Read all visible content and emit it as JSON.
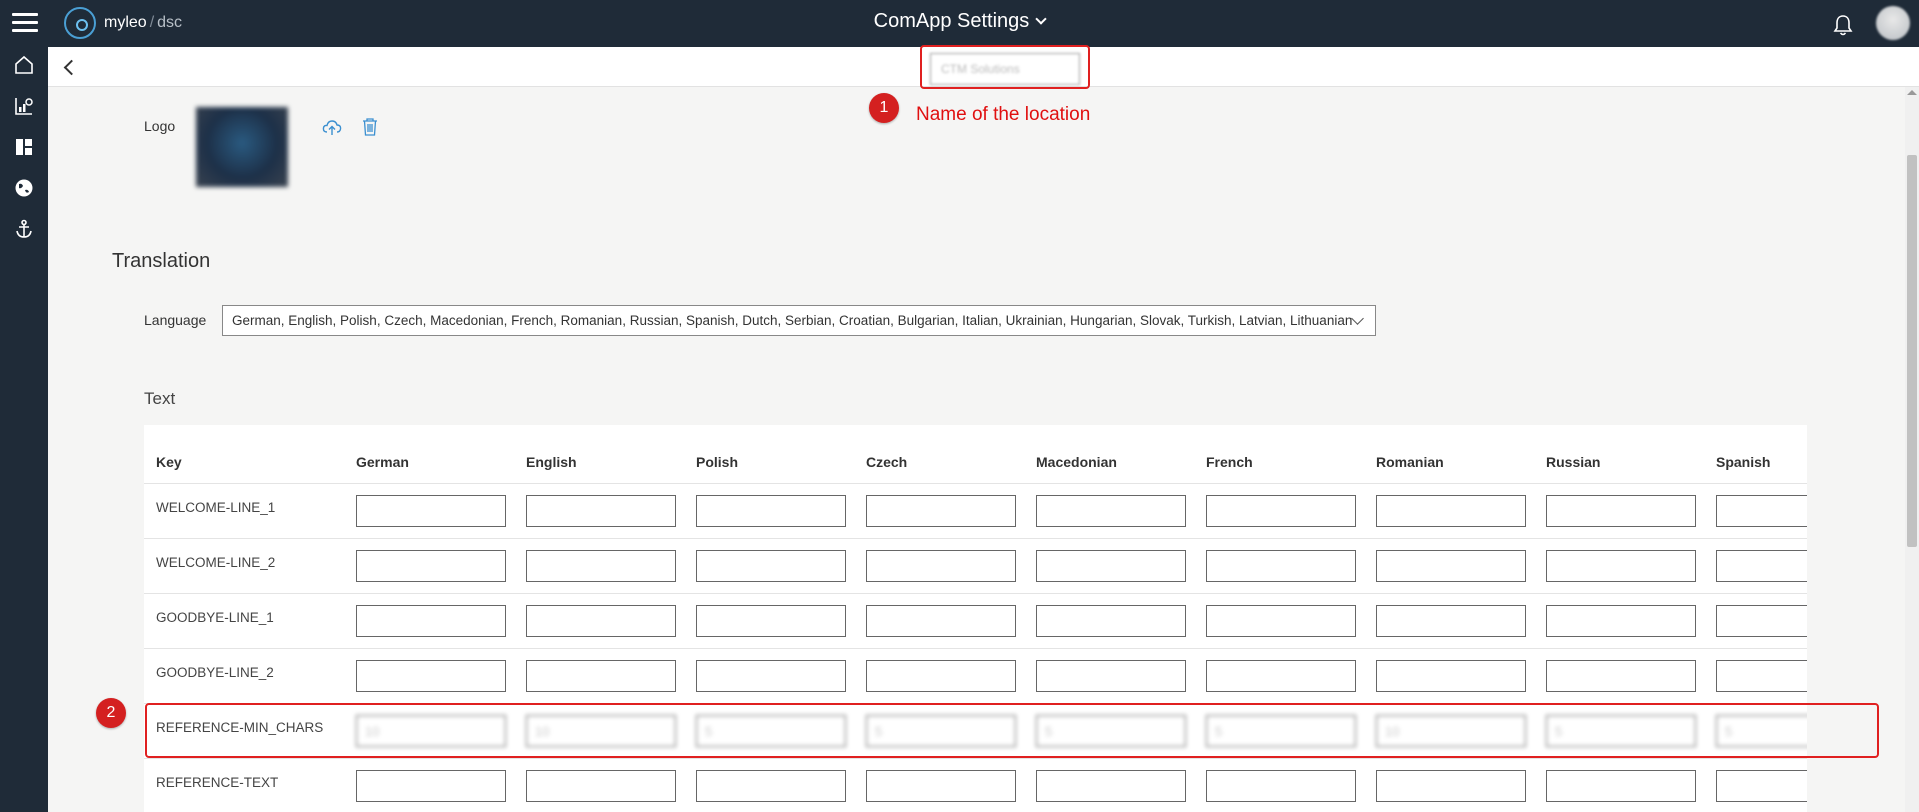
{
  "header": {
    "brand_name": "myleo",
    "brand_separator": "/",
    "brand_sub": "dsc",
    "title": "ComApp Settings"
  },
  "sidenav": {
    "items": [
      {
        "icon": "home-icon"
      },
      {
        "icon": "analytics-icon"
      },
      {
        "icon": "dashboard-icon"
      },
      {
        "icon": "globe-icon"
      },
      {
        "icon": "anchor-icon"
      }
    ]
  },
  "location": {
    "value": "CTM Solutions"
  },
  "logo": {
    "label": "Logo"
  },
  "annotations": {
    "badge_1": "1",
    "badge_1_text": "Name of the location",
    "badge_2": "2",
    "color": "#e02020"
  },
  "translation": {
    "title": "Translation",
    "language_label": "Language",
    "language_value": "German, English, Polish, Czech, Macedonian, French, Romanian, Russian, Spanish, Dutch, Serbian, Croatian, Bulgarian, Italian, Ukrainian, Hungarian, Slovak, Turkish, Latvian, Lithuanian",
    "text_label": "Text"
  },
  "table": {
    "key_header": "Key",
    "columns": [
      "German",
      "English",
      "Polish",
      "Czech",
      "Macedonian",
      "French",
      "Romanian",
      "Russian",
      "Spanish"
    ],
    "rows": [
      {
        "key": "WELCOME-LINE_1",
        "values": [
          "",
          "",
          "",
          "",
          "",
          "",
          "",
          "",
          ""
        ]
      },
      {
        "key": "WELCOME-LINE_2",
        "values": [
          "",
          "",
          "",
          "",
          "",
          "",
          "",
          "",
          ""
        ]
      },
      {
        "key": "GOODBYE-LINE_1",
        "values": [
          "",
          "",
          "",
          "",
          "",
          "",
          "",
          "",
          ""
        ]
      },
      {
        "key": "GOODBYE-LINE_2",
        "values": [
          "",
          "",
          "",
          "",
          "",
          "",
          "",
          "",
          ""
        ]
      },
      {
        "key": "REFERENCE-MIN_CHARS",
        "values": [
          "10",
          "10",
          "5",
          "5",
          "5",
          "5",
          "10",
          "5",
          "5"
        ],
        "blurred": true
      },
      {
        "key": "REFERENCE-TEXT",
        "values": [
          "",
          "",
          "",
          "",
          "",
          "",
          "",
          "",
          ""
        ]
      }
    ]
  }
}
